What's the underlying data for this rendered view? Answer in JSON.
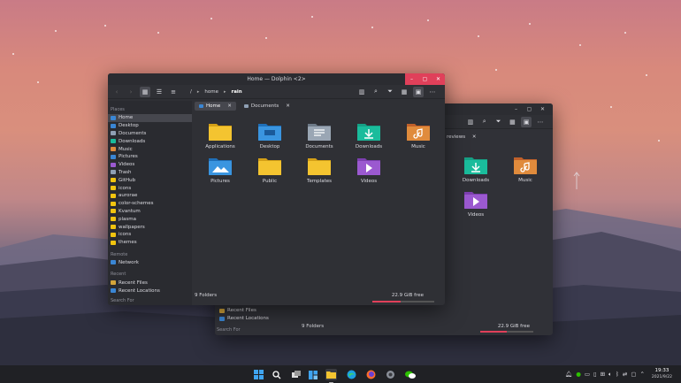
{
  "colors": {
    "accent": "#e0405a",
    "window_bg": "#2f3035",
    "sidebar_bg": "#2a2b30",
    "taskbar_bg": "#202125"
  },
  "back_window": {
    "tab_label": "reviews",
    "files": [
      {
        "label": "Downloads",
        "icon": "folder-downloads-icon"
      },
      {
        "label": "Music",
        "icon": "folder-music-icon"
      },
      {
        "label": "Videos",
        "icon": "folder-videos-icon"
      }
    ],
    "sidebar_recent": [
      "Recent Files",
      "Recent Locations"
    ],
    "search_for": "Search For",
    "status_count": "9 Folders",
    "status_free": "22.9 GiB free"
  },
  "window": {
    "title": "Home — Dolphin <2>",
    "breadcrumb": [
      "/",
      "home",
      "rain"
    ],
    "tabs": [
      {
        "label": "Home",
        "active": true
      },
      {
        "label": "Documents",
        "active": false
      }
    ],
    "sidebar": {
      "places_header": "Places",
      "places": [
        "Home",
        "Desktop",
        "Documents",
        "Downloads",
        "Music",
        "Pictures",
        "Videos",
        "Trash",
        "GitHub",
        "icons",
        "aurorae",
        "color-schemes",
        "Kvantum",
        "plasma",
        "wallpapers",
        "icons",
        "themes"
      ],
      "remote_header": "Remote",
      "remote": [
        "Network"
      ],
      "recent_header": "Recent",
      "recent": [
        "Recent Files",
        "Recent Locations"
      ],
      "search_header": "Search For"
    },
    "files": [
      {
        "label": "Applications",
        "icon": "folder-icon"
      },
      {
        "label": "Desktop",
        "icon": "folder-desktop-icon"
      },
      {
        "label": "Documents",
        "icon": "folder-documents-icon"
      },
      {
        "label": "Downloads",
        "icon": "folder-downloads-icon"
      },
      {
        "label": "Music",
        "icon": "folder-music-icon"
      },
      {
        "label": "Pictures",
        "icon": "folder-pictures-icon"
      },
      {
        "label": "Public",
        "icon": "folder-icon"
      },
      {
        "label": "Templates",
        "icon": "folder-icon"
      },
      {
        "label": "Videos",
        "icon": "folder-videos-icon"
      }
    ],
    "status_count": "9 Folders",
    "status_free": "22.9 GiB free",
    "free_fraction": 0.45
  },
  "taskbar": {
    "apps": [
      "start-icon",
      "search-icon",
      "task-view-icon",
      "widgets-icon",
      "file-manager-icon",
      "edge-icon",
      "firefox-icon",
      "settings-icon",
      "wechat-icon"
    ],
    "time": "19:33",
    "date": "2021/9/22"
  }
}
